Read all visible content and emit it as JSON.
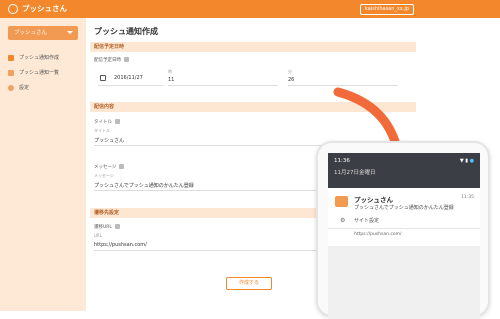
{
  "app": {
    "logo_text": "プッシュさん",
    "account_button": "kaishihasan_xx.jp"
  },
  "sidebar": {
    "site_select": "プッシュさん",
    "items": [
      {
        "label": "プッシュ通知作成",
        "icon": "notification-icon"
      },
      {
        "label": "プッシュ通知一覧",
        "icon": "list-icon"
      },
      {
        "label": "設定",
        "icon": "gear-icon"
      }
    ]
  },
  "main": {
    "title": "プッシュ通知作成",
    "sections": {
      "schedule": "配信予定日時",
      "content": "配信内容",
      "transition": "遷移先設定"
    },
    "schedule": {
      "label": "配信予定日時",
      "date": "2016/11/27",
      "hour_label": "時",
      "hour": "11",
      "minute_label": "分",
      "minute": "26"
    },
    "content": {
      "title_label": "タイトル",
      "title_sublabel": "タイトル",
      "title_value": "プッシュさん",
      "message_label": "メッセージ",
      "message_sublabel": "メッセージ",
      "message_value": "プッシュさんでプッシュ通知のかんたん登録"
    },
    "transition": {
      "url_label": "遷移URL",
      "url_sublabel": "URL",
      "url_value": "https://pushsan.com/"
    },
    "create_button": "作成する"
  },
  "phone": {
    "status_time": "11:36",
    "status_date": "11月27日金曜日",
    "notification": {
      "title": "プッシュさん",
      "time": "11:35",
      "body": "プッシュさんでプッシュ通知のかんたん登録",
      "settings": "サイト設定",
      "url": "https://pushsan.com/"
    }
  },
  "colors": {
    "accent": "#f2882b",
    "sidebar_bg": "#fde9d6",
    "arrow": "#f26a3a"
  }
}
